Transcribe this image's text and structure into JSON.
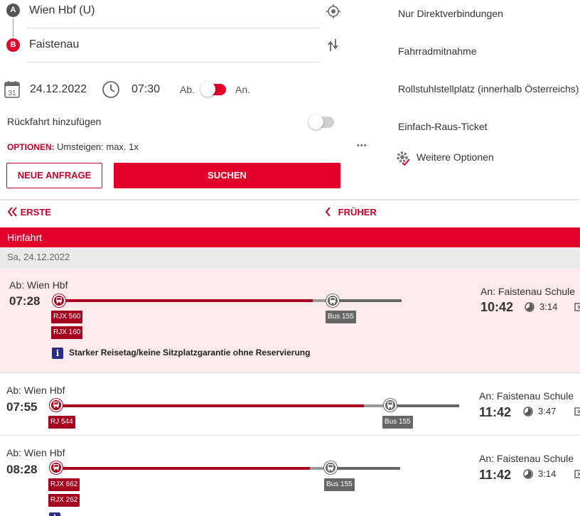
{
  "search": {
    "from_badge": "A",
    "to_badge": "B",
    "from_station": "Wien Hbf (U)",
    "to_station": "Faistenau",
    "date": "24.12.2022",
    "time": "07:30",
    "dep_label": "Ab.",
    "arr_label": "An.",
    "return_label": "Rückfahrt hinzufügen",
    "options_label": "OPTIONEN:",
    "options_value": "Umsteigen: max. 1x",
    "new_request_button": "NEUE ANFRAGE",
    "search_button": "SUCHEN",
    "more_dots": "•••"
  },
  "filters": {
    "items": [
      "Nur Direktverbindungen",
      "Fahrradmitnahme",
      "Rollstuhlstellplatz (innerhalb Österreichs)",
      "Einfach-Raus-Ticket"
    ],
    "more_options": "Weitere Optionen"
  },
  "nav": {
    "first": "ERSTE",
    "earlier": "FRÜHER"
  },
  "results": {
    "section_title": "Hinfahrt",
    "date_header": "Sa, 24.12.2022",
    "connections": [
      {
        "dep_label": "Ab: Wien Hbf",
        "dep_time": "07:28",
        "trains": [
          "RJX 560",
          "RJX 160"
        ],
        "bus": "Bus 155",
        "arr_label": "An: Faistenau Schule",
        "arr_time": "10:42",
        "duration": "3:14",
        "notice": "Starker Reisetag/keine Sitzplatzgarantie ohne Reservierung"
      },
      {
        "dep_label": "Ab: Wien Hbf",
        "dep_time": "07:55",
        "trains": [
          "RJ 544"
        ],
        "bus": "Bus 155",
        "arr_label": "An: Faistenau Schule",
        "arr_time": "11:42",
        "duration": "3:47"
      },
      {
        "dep_label": "Ab: Wien Hbf",
        "dep_time": "08:28",
        "trains": [
          "RJX 662",
          "RJX 262"
        ],
        "bus": "Bus 155",
        "arr_label": "An: Faistenau Schule",
        "arr_time": "11:42",
        "duration": "3:14"
      }
    ]
  },
  "colors": {
    "brand_red": "#e2002a",
    "dark_red": "#a5001f",
    "highlight_bg": "#fdeaea",
    "bus_gray": "#666666"
  },
  "icons": {
    "location": "crosshair-icon",
    "swap": "swap-arrows-icon",
    "calendar": "calendar-icon",
    "clock": "clock-icon",
    "settings": "gear-check-icon",
    "train": "train-icon",
    "bus": "bus-icon",
    "info": "info-icon",
    "duration": "duration-pie-icon"
  }
}
